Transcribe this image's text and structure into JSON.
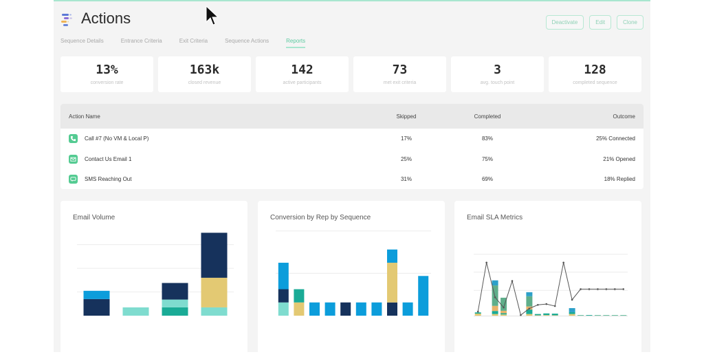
{
  "header": {
    "title": "Actions",
    "buttons": [
      {
        "label": "Deactivate"
      },
      {
        "label": "Edit"
      },
      {
        "label": "Clone"
      }
    ]
  },
  "tabs": [
    {
      "label": "Sequence Details",
      "active": false
    },
    {
      "label": "Entrance Criteria",
      "active": false
    },
    {
      "label": "Exit Criteria",
      "active": false
    },
    {
      "label": "Sequence Actions",
      "active": false
    },
    {
      "label": "Reports",
      "active": true
    }
  ],
  "stats": [
    {
      "value": "13%",
      "label": "conversion rate"
    },
    {
      "value": "163k",
      "label": "closed revenue"
    },
    {
      "value": "142",
      "label": "active participants"
    },
    {
      "value": "73",
      "label": "met exit criteria"
    },
    {
      "value": "3",
      "label": "avg. touch point"
    },
    {
      "value": "128",
      "label": "completed sequence"
    }
  ],
  "table": {
    "columns": [
      "Action Name",
      "Skipped",
      "Completed",
      "Outcome"
    ],
    "rows": [
      {
        "icon": "phone-icon",
        "name": "Call #7 (No VM & Local P)",
        "skipped": "17%",
        "completed": "83%",
        "outcome": "25% Connected"
      },
      {
        "icon": "email-icon",
        "name": "Contact Us Email 1",
        "skipped": "25%",
        "completed": "75%",
        "outcome": "21% Opened"
      },
      {
        "icon": "sms-icon",
        "name": "SMS Reaching Out",
        "skipped": "31%",
        "completed": "69%",
        "outcome": "18% Replied"
      }
    ]
  },
  "colors": {
    "accent": "#5cc9a0",
    "navy": "#16325c",
    "blue": "#0c9ddb",
    "light_teal": "#7fdccf",
    "teal": "#1aab96",
    "yellow": "#e3c973",
    "icon_green": "#54cb92"
  },
  "chart_data": [
    {
      "type": "bar",
      "stacked": true,
      "title": "Email Volume",
      "categories": [
        "1",
        "2",
        "3",
        "4"
      ],
      "series": [
        {
          "name": "teal",
          "color": "#1aab96",
          "values": [
            0,
            0,
            3.5,
            0
          ]
        },
        {
          "name": "light-teal",
          "color": "#7fdccf",
          "values": [
            0,
            3.5,
            3.3,
            3.5
          ]
        },
        {
          "name": "navy",
          "color": "#16325c",
          "values": [
            7,
            0,
            7,
            0
          ]
        },
        {
          "name": "yellow",
          "color": "#e3c973",
          "values": [
            0,
            0,
            0,
            12.5
          ]
        },
        {
          "name": "blue",
          "color": "#0c9ddb",
          "values": [
            3.5,
            0,
            0,
            0
          ]
        },
        {
          "name": "navy-top",
          "color": "#16325c",
          "values": [
            0,
            0,
            0,
            19
          ]
        }
      ],
      "ylim": [
        0,
        36
      ],
      "gridlines": [
        10,
        20,
        30
      ],
      "grid": true,
      "xlabel": "",
      "ylabel": ""
    },
    {
      "type": "bar",
      "stacked": true,
      "title": "Conversion by Rep by Sequence",
      "categories": [
        "1",
        "2",
        "3",
        "4",
        "5",
        "6",
        "7",
        "8",
        "9",
        "10"
      ],
      "series": [
        {
          "name": "light-teal",
          "color": "#7fdccf",
          "values": [
            1,
            0,
            0,
            0,
            0,
            0,
            0,
            0,
            0,
            0
          ]
        },
        {
          "name": "yellow-base",
          "color": "#e3c973",
          "values": [
            0,
            1,
            0,
            0,
            0,
            0,
            0,
            0,
            0,
            0
          ]
        },
        {
          "name": "navy",
          "color": "#16325c",
          "values": [
            1,
            0,
            0,
            0,
            1,
            0,
            0,
            1,
            0,
            0
          ]
        },
        {
          "name": "teal",
          "color": "#1aab96",
          "values": [
            0,
            1,
            0,
            0,
            0,
            0,
            0,
            0,
            0,
            0
          ]
        },
        {
          "name": "yellow",
          "color": "#e3c973",
          "values": [
            0,
            0,
            0,
            0,
            0,
            0,
            0,
            3,
            0,
            0
          ]
        },
        {
          "name": "blue",
          "color": "#0c9ddb",
          "values": [
            2,
            0,
            1,
            1,
            0,
            1,
            1,
            1,
            1,
            3
          ]
        }
      ],
      "ylim": [
        0,
        6.6
      ],
      "gridlines": [
        3.2,
        6.4
      ],
      "grid": true,
      "xlabel": "",
      "ylabel": ""
    },
    {
      "type": "bar+line",
      "stacked": true,
      "title": "Email SLA Metrics",
      "categories": [
        "1",
        "2",
        "3",
        "4",
        "5",
        "6",
        "7",
        "8",
        "9",
        "10",
        "11",
        "12",
        "13",
        "14",
        "15",
        "16",
        "17",
        "18"
      ],
      "series": [
        {
          "name": "yellow",
          "color": "#e3c973",
          "values": [
            1,
            0,
            0.8,
            0.6,
            0,
            0,
            0.8,
            0.2,
            0.3,
            0.2,
            0,
            0.8,
            0.1,
            0,
            0.1,
            0.1,
            0.1,
            0.1
          ]
        },
        {
          "name": "teal",
          "color": "#1aab96",
          "values": [
            0.6,
            0,
            1.5,
            0.6,
            0,
            0,
            2.2,
            0.6,
            0.8,
            0.8,
            0,
            0.9,
            0.2,
            0.3,
            0.2,
            0.2,
            0.2,
            0.2
          ]
        },
        {
          "name": "orange",
          "color": "#e9b36b",
          "values": [
            0,
            0,
            2.5,
            1.2,
            0,
            0,
            1.5,
            0,
            0,
            0,
            0,
            0,
            0,
            0,
            0,
            0,
            0,
            0
          ]
        },
        {
          "name": "green",
          "color": "#5fae8a",
          "values": [
            0,
            0,
            10,
            6.4,
            0,
            0,
            5,
            0,
            0,
            0,
            0,
            0,
            0,
            0,
            0,
            0,
            0,
            0
          ]
        },
        {
          "name": "cyan",
          "color": "#2da0c9",
          "values": [
            0,
            0,
            2.5,
            0,
            0,
            0,
            2,
            0,
            0,
            0,
            0,
            2,
            0,
            0,
            0,
            0,
            0,
            0
          ]
        }
      ],
      "line": {
        "name": "SLA",
        "color": "#555555",
        "values": [
          2,
          26,
          9,
          4,
          17,
          0.3,
          3.5,
          5.3,
          5.7,
          4.7,
          26,
          7.8,
          13,
          13,
          13,
          13,
          13,
          13
        ]
      },
      "ylim": [
        0,
        31
      ],
      "gridlines": [
        12.4,
        21.3,
        30.1
      ],
      "grid": true,
      "xlabel": "",
      "ylabel": ""
    }
  ]
}
